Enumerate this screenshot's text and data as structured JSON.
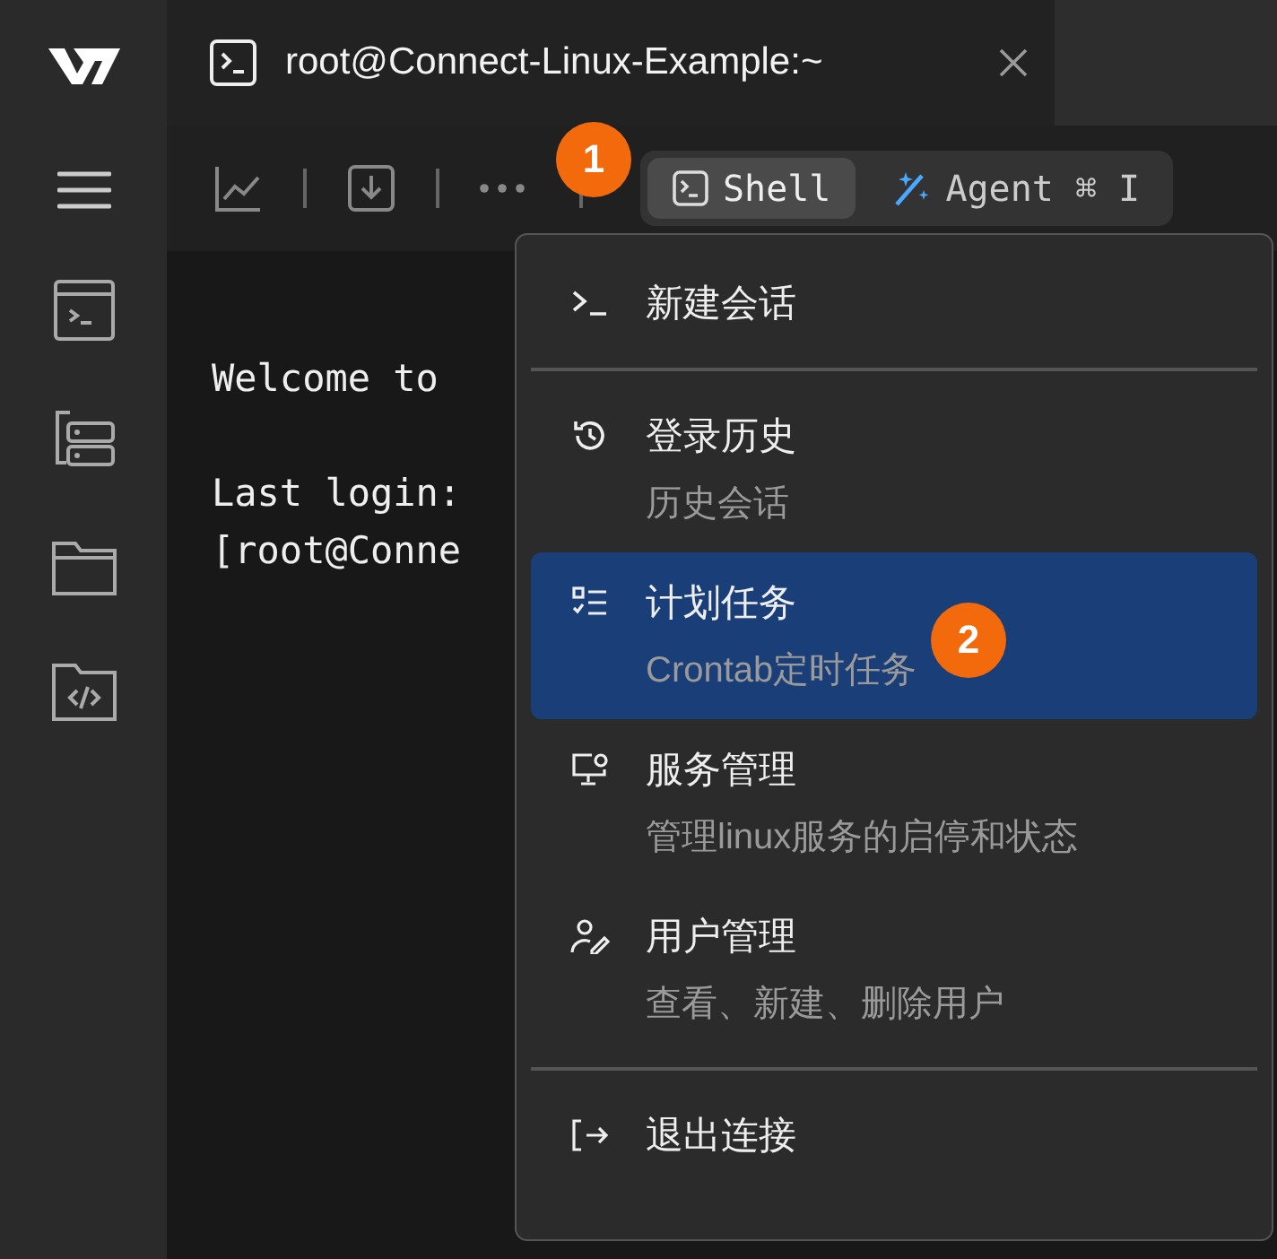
{
  "tab": {
    "title": "root@Connect-Linux-Example:~"
  },
  "modes": [
    {
      "label": "Shell",
      "selected": true
    },
    {
      "label": "Agent",
      "shortcut": "⌘ I",
      "selected": false
    }
  ],
  "terminal": {
    "lines": [
      "Welcome to",
      "Last login:",
      "[root@Conne"
    ]
  },
  "menu": {
    "items": [
      {
        "kind": "item",
        "label": "新建会话",
        "selected": false
      },
      {
        "kind": "divider"
      },
      {
        "kind": "item",
        "label": "登录历史",
        "description": "历史会话",
        "selected": false
      },
      {
        "kind": "item",
        "label": "计划任务",
        "description": "Crontab定时任务",
        "selected": true
      },
      {
        "kind": "item",
        "label": "服务管理",
        "description": "管理linux服务的启停和状态",
        "selected": false
      },
      {
        "kind": "item",
        "label": "用户管理",
        "description": "查看、新建、删除用户",
        "selected": false
      },
      {
        "kind": "divider"
      },
      {
        "kind": "item",
        "label": "退出连接",
        "selected": false
      }
    ]
  },
  "callouts": [
    {
      "label": "1"
    },
    {
      "label": "2"
    }
  ]
}
